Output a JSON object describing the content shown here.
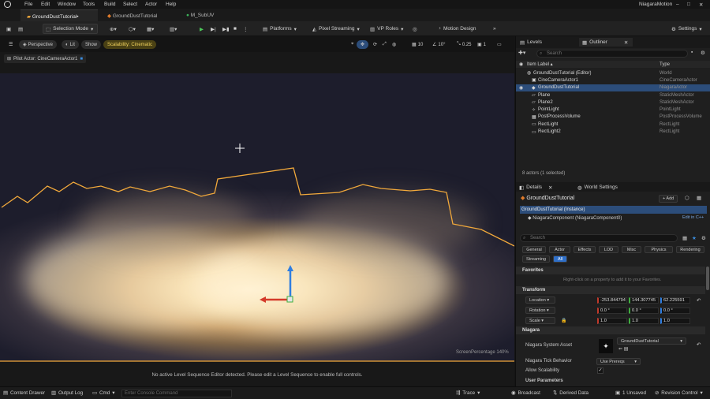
{
  "menu": [
    "File",
    "Edit",
    "Window",
    "Tools",
    "Build",
    "Select",
    "Actor",
    "Help"
  ],
  "app_title": "NiagaraMotion",
  "doc_tabs": [
    "GroundDustTutorial•",
    "GroundDustTutorial",
    "M_SubUV"
  ],
  "toolbar": {
    "selection_mode": "Selection Mode",
    "platforms": "Platforms",
    "pixel_streaming": "Pixel Streaming",
    "vp_roles": "VP Roles",
    "motion_design": "Motion Design",
    "settings": "Settings"
  },
  "viewport": {
    "perspective": "Perspective",
    "lit": "Lit",
    "show": "Show",
    "scalability": "Scalability: Cinematic",
    "grid_snap": "10",
    "rot_snap": "10°",
    "scale_snap": "0.25",
    "cam_speed": "1",
    "pilot_actor": "Pilot Actor: CineCameraActor1",
    "screen_percentage": "ScreenPercentage  140%",
    "status_msg": "No active Level Sequence Editor detected. Please edit a Level Sequence to enable full controls."
  },
  "outliner": {
    "tabs": [
      "Levels",
      "Outliner"
    ],
    "search_placeholder": "Search",
    "col_label": "Item Label ▴",
    "col_type": "Type",
    "rows": [
      {
        "label": "GroundDustTutorial (Editor)",
        "type": "World"
      },
      {
        "label": "CineCameraActor1",
        "type": "CineCameraActor"
      },
      {
        "label": "GroundDustTutorial",
        "type": "NiagaraActor"
      },
      {
        "label": "Plane",
        "type": "StaticMeshActor"
      },
      {
        "label": "Plane2",
        "type": "StaticMeshActor"
      },
      {
        "label": "PointLight",
        "type": "PointLight"
      },
      {
        "label": "PostProcessVolume",
        "type": "PostProcessVolume"
      },
      {
        "label": "RectLight",
        "type": "RectLight"
      },
      {
        "label": "RectLight2",
        "type": "RectLight"
      }
    ],
    "count": "8 actors (1 selected)"
  },
  "details": {
    "tabs": [
      "Details",
      "World Settings"
    ],
    "actor_name": "GroundDustTutorial",
    "add_label": "+ Add",
    "instance": "GroundDustTutorial (Instance)",
    "component": "NiagaraComponent (NiagaraComponent0)",
    "edit_cpp": "Edit in C++",
    "search_placeholder": "Search",
    "filter_tabs": [
      "General",
      "Actor",
      "Effects",
      "LOD",
      "Misc",
      "Physics",
      "Rendering",
      "Streaming",
      "All"
    ],
    "favorites": "Favorites",
    "favorites_hint": "Right-click on a property to add it to your Favorites.",
    "transform": "Transform",
    "location_label": "Location",
    "rotation_label": "Rotation",
    "scale_label": "Scale",
    "location": [
      "-253.844794",
      "144.307745",
      "62.225591"
    ],
    "rotation": [
      "0.0 °",
      "0.0 °",
      "0.0 °"
    ],
    "scale": [
      "1.0",
      "1.0",
      "1.0"
    ],
    "niagara": "Niagara",
    "system_asset_label": "Niagara System Asset",
    "system_asset": "GroundDustTutorial",
    "tick_label": "Niagara Tick Behavior",
    "tick_value": "Use Prereqs",
    "allow_scalability": "Allow Scalability",
    "user_params": "User Parameters"
  },
  "bottom": {
    "content_drawer": "Content Drawer",
    "output_log": "Output Log",
    "cmd": "Cmd",
    "console_placeholder": "Enter Console Command",
    "trace": "Trace",
    "broadcast": "Broadcast",
    "derived_data": "Derived Data",
    "unsaved": "1 Unsaved",
    "revision": "Revision Control"
  },
  "colors": {
    "accent_orange": "#f2a93b",
    "selection_blue": "#2c4d7a",
    "scalability_badge": "#c9a635"
  }
}
